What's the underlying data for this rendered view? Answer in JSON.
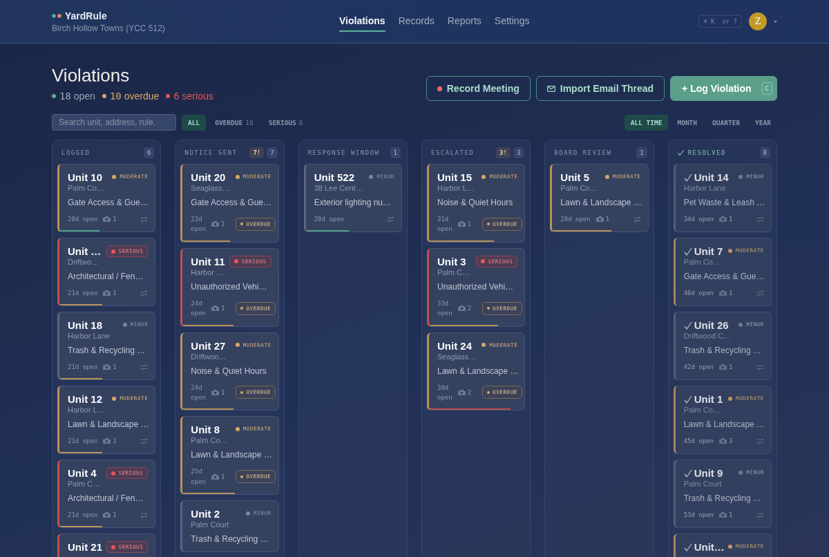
{
  "app": {
    "name": "YardRule",
    "community": "Birch Hollow Towns (YCC 512)"
  },
  "nav": [
    {
      "label": "Violations",
      "selected": true
    },
    {
      "label": "Records",
      "selected": false
    },
    {
      "label": "Reports",
      "selected": false
    },
    {
      "label": "Settings",
      "selected": false
    }
  ],
  "shortcut_hint": "⌘ K  or ?",
  "avatar": "Z",
  "page_title": "Violations",
  "stats": [
    {
      "count": "18",
      "label": "open",
      "color": "#5fae93"
    },
    {
      "count": "10",
      "label": "overdue",
      "color": "#d7a965"
    },
    {
      "count": "6",
      "label": "serious",
      "color": "#e0585b"
    }
  ],
  "actions": [
    {
      "kind": "record",
      "label": "Record Meeting"
    },
    {
      "kind": "import",
      "label": "Import Email Thread"
    },
    {
      "kind": "primary",
      "label": "+ Log Violation",
      "key": "C"
    }
  ],
  "search": {
    "placeholder": "Search unit, address, rule."
  },
  "filters": [
    {
      "label": "ALL",
      "selected": true
    },
    {
      "label": "OVERDUE",
      "count": "10",
      "selected": false
    },
    {
      "label": "SERIOUS",
      "count": "6",
      "selected": false
    }
  ],
  "periods": [
    {
      "label": "ALL TIME",
      "selected": true
    },
    {
      "label": "MONTH",
      "selected": false
    },
    {
      "label": "QUARTER",
      "selected": false
    },
    {
      "label": "YEAR",
      "selected": false
    }
  ],
  "columns": [
    {
      "title": "LOGGED",
      "count": "6",
      "done": false,
      "cards": [
        {
          "unit": "Unit 10",
          "kind": "moderate",
          "severity": "MODERATE",
          "address": "Palm Co…",
          "rule": "Gate Access & Gue…",
          "age": "20d open",
          "photos": "1",
          "overdue": false,
          "resolved": false,
          "progress": {
            "level": 0.42,
            "color": "#4f9f86"
          }
        },
        {
          "unit": "Unit …",
          "kind": "serious",
          "severity": "SERIOUS",
          "address": "Driftwo…",
          "rule": "Architectural / Fen…",
          "age": "21d open",
          "photos": "1",
          "overdue": false,
          "resolved": false,
          "progress": {
            "level": 0.45,
            "color": "#b8925a"
          }
        },
        {
          "unit": "Unit 18",
          "kind": "minor",
          "severity": "MINOR",
          "address": "Harbor Lane",
          "rule": "Trash & Recycling …",
          "age": "21d open",
          "photos": "1",
          "overdue": false,
          "resolved": false,
          "progress": {
            "level": 0.45,
            "color": "#b8925a"
          }
        },
        {
          "unit": "Unit 12",
          "kind": "moderate",
          "severity": "MODERATE",
          "address": "Harbor L…",
          "rule": "Lawn & Landscape …",
          "age": "21d open",
          "photos": "1",
          "overdue": false,
          "resolved": false,
          "progress": {
            "level": 0.45,
            "color": "#b8925a"
          }
        },
        {
          "unit": "Unit 4",
          "kind": "serious",
          "severity": "SERIOUS",
          "address": "Palm C…",
          "rule": "Architectural / Fen…",
          "age": "21d open",
          "photos": "1",
          "overdue": false,
          "resolved": false,
          "progress": {
            "level": 0.45,
            "color": "#b8925a"
          }
        },
        {
          "unit": "Unit 21",
          "kind": "serious",
          "severity": "SERIOUS",
          "resolved": false
        }
      ]
    },
    {
      "title": "NOTICE SENT",
      "alert": "7!",
      "count": "7",
      "done": false,
      "cards": [
        {
          "unit": "Unit 20",
          "kind": "moderate",
          "severity": "MODERATE",
          "address": "Seaglass…",
          "rule": "Gate Access & Gue…",
          "age": "23d open",
          "photos": "1",
          "overdue": true,
          "overdue_label": "OVERDUE",
          "resolved": false,
          "progress": {
            "level": 0.5,
            "color": "#b8925a"
          }
        },
        {
          "unit": "Unit 11",
          "kind": "serious",
          "severity": "SERIOUS",
          "address": "Harbor …",
          "rule": "Unauthorized Vehi…",
          "age": "24d open",
          "photos": "1",
          "overdue": true,
          "overdue_label": "OVERDUE",
          "resolved": false,
          "progress": {
            "level": 0.53,
            "color": "#b8925a"
          }
        },
        {
          "unit": "Unit 27",
          "kind": "moderate",
          "severity": "MODERATE",
          "address": "Driftwoo…",
          "rule": "Noise & Quiet Hours",
          "age": "24d open",
          "photos": "1",
          "overdue": true,
          "overdue_label": "OVERDUE",
          "resolved": false,
          "progress": {
            "level": 0.53,
            "color": "#b8925a"
          }
        },
        {
          "unit": "Unit 8",
          "kind": "moderate",
          "severity": "MODERATE",
          "address": "Palm Co…",
          "rule": "Lawn & Landscape …",
          "age": "25d open",
          "photos": "1",
          "overdue": true,
          "overdue_label": "OVERDUE",
          "resolved": false,
          "progress": {
            "level": 0.55,
            "color": "#b8925a"
          }
        },
        {
          "unit": "Unit 2",
          "kind": "minor",
          "severity": "MINOR",
          "address": "Palm Court",
          "rule": "Trash & Recycling …",
          "resolved": false
        }
      ]
    },
    {
      "title": "RESPONSE WINDOW",
      "count": "1",
      "done": false,
      "cards": [
        {
          "unit": "Unit 522",
          "kind": "minor",
          "severity": "MINOR",
          "address": "38 Lee Cent…",
          "rule": "Exterior lighting nu…",
          "age": "20d open",
          "overdue": false,
          "resolved": false,
          "progress": {
            "level": 0.45,
            "color": "#4f9f86"
          }
        }
      ]
    },
    {
      "title": "ESCALATED",
      "alert": "3!",
      "count": "3",
      "done": false,
      "cards": [
        {
          "unit": "Unit 15",
          "kind": "moderate",
          "severity": "MODERATE",
          "address": "Harbor L…",
          "rule": "Noise & Quiet Hours",
          "age": "31d open",
          "photos": "1",
          "overdue": true,
          "overdue_label": "OVERDUE",
          "resolved": false,
          "progress": {
            "level": 0.68,
            "color": "#b8925a"
          }
        },
        {
          "unit": "Unit 3",
          "kind": "serious",
          "severity": "SERIOUS",
          "address": "Palm C…",
          "rule": "Unauthorized Vehi…",
          "age": "33d open",
          "photos": "2",
          "overdue": true,
          "overdue_label": "OVERDUE",
          "resolved": false,
          "progress": {
            "level": 0.72,
            "color": "#b8925a"
          }
        },
        {
          "unit": "Unit 24",
          "kind": "moderate",
          "severity": "MODERATE",
          "address": "Seaglass…",
          "rule": "Lawn & Landscape …",
          "age": "38d open",
          "photos": "2",
          "overdue": true,
          "overdue_label": "OVERDUE",
          "resolved": false,
          "progress": {
            "level": 0.85,
            "color": "#c0504f"
          }
        }
      ]
    },
    {
      "title": "BOARD REVIEW",
      "count": "1",
      "done": false,
      "cards": [
        {
          "unit": "Unit 5",
          "kind": "moderate",
          "severity": "MODERATE",
          "address": "Palm Co…",
          "rule": "Lawn & Landscape …",
          "age": "28d open",
          "photos": "1",
          "overdue": false,
          "resolved": false,
          "progress": {
            "level": 0.62,
            "color": "#b8925a"
          }
        }
      ]
    },
    {
      "title": "RESOLVED",
      "count": "8",
      "done": true,
      "cards": [
        {
          "unit": "Unit 14",
          "kind": "minor",
          "severity": "MINOR",
          "address": "Harbor Lane",
          "rule": "Pet Waste & Leash …",
          "age": "34d open",
          "photos": "1",
          "overdue": false,
          "resolved": true
        },
        {
          "unit": "Unit 7",
          "kind": "moderate",
          "severity": "MODERATE",
          "address": "Palm Co…",
          "rule": "Gate Access & Gue…",
          "age": "40d open",
          "photos": "1",
          "overdue": false,
          "resolved": true
        },
        {
          "unit": "Unit 26",
          "kind": "minor",
          "severity": "MINOR",
          "address": "Driftwood C…",
          "rule": "Trash & Recycling …",
          "age": "42d open",
          "photos": "1",
          "overdue": false,
          "resolved": true
        },
        {
          "unit": "Unit 1",
          "kind": "moderate",
          "severity": "MODERATE",
          "address": "Palm Co…",
          "rule": "Lawn & Landscape …",
          "age": "45d open",
          "photos": "3",
          "overdue": false,
          "resolved": true
        },
        {
          "unit": "Unit 9",
          "kind": "minor",
          "severity": "MINOR",
          "address": "Palm Court",
          "rule": "Trash & Recycling …",
          "age": "53d open",
          "photos": "1",
          "overdue": false,
          "resolved": true
        },
        {
          "unit": "Unit…",
          "kind": "moderate",
          "severity": "MODERATE",
          "resolved": true
        }
      ]
    }
  ]
}
